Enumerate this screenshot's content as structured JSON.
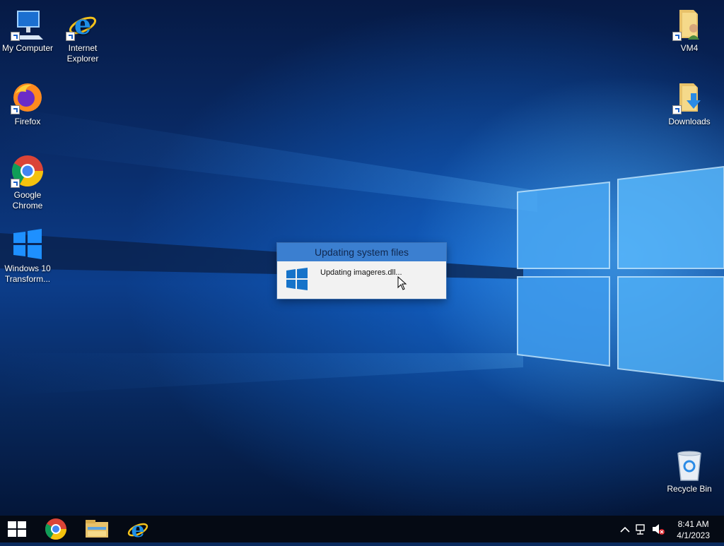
{
  "desktop": {
    "icons_left": [
      {
        "label": "My Computer"
      },
      {
        "label": "Internet Explorer"
      },
      {
        "label": "Firefox"
      },
      {
        "label": "Google Chrome"
      },
      {
        "label": "Windows 10 Transform..."
      }
    ],
    "icons_right": [
      {
        "label": "VM4"
      },
      {
        "label": "Downloads"
      },
      {
        "label": "Recycle Bin"
      }
    ]
  },
  "dialog": {
    "title": "Updating system files",
    "message": "Updating imageres.dll..."
  },
  "taskbar": {
    "time": "8:41 AM",
    "date": "4/1/2023"
  },
  "colors": {
    "accent": "#3b7fd0",
    "taskbar": "#050a14"
  }
}
